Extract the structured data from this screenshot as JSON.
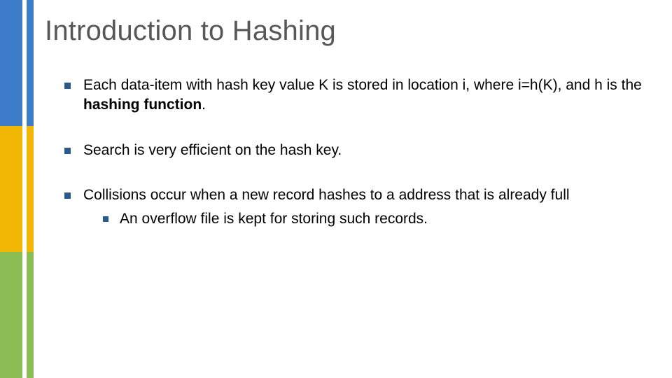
{
  "title": "Introduction to Hashing",
  "bullets": {
    "b1_pre": "Each data-item with hash key value K is stored in location i, where i=h(K), and h is the ",
    "b1_bold": "hashing function",
    "b1_post": ".",
    "b2": "Search is very efficient on the hash key.",
    "b3": "Collisions occur when a new record hashes to a address that is already full",
    "b3_sub": "An overflow file is kept for storing such records."
  }
}
